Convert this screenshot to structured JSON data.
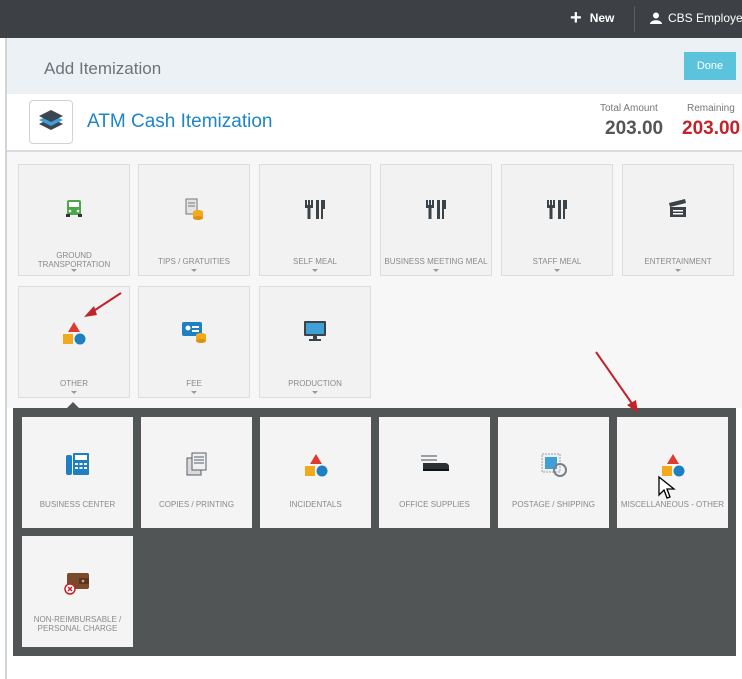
{
  "topbar": {
    "new_label": "New",
    "user_label": "CBS Employee"
  },
  "header": {
    "title": "Add Itemization",
    "done_label": "Done"
  },
  "itemization": {
    "name": "ATM Cash Itemization",
    "total_label": "Total Amount",
    "total_value": "203.00",
    "remaining_label": "Remaining",
    "remaining_value": "203.00"
  },
  "categories": [
    {
      "label": "GROUND TRANSPORTATION",
      "icon": "car-icon"
    },
    {
      "label": "TIPS / GRATUITIES",
      "icon": "tips-icon"
    },
    {
      "label": "SELF MEAL",
      "icon": "fork-knife-icon"
    },
    {
      "label": "BUSINESS MEETING MEAL",
      "icon": "fork-knife-icon"
    },
    {
      "label": "STAFF MEAL",
      "icon": "fork-knife-icon"
    },
    {
      "label": "ENTERTAINMENT",
      "icon": "clapperboard-icon"
    },
    {
      "label": "OTHER",
      "icon": "shapes-icon"
    },
    {
      "label": "FEE",
      "icon": "fee-icon"
    },
    {
      "label": "PRODUCTION",
      "icon": "monitor-icon"
    }
  ],
  "subcategories": [
    {
      "label": "BUSINESS CENTER",
      "icon": "fax-icon"
    },
    {
      "label": "COPIES / PRINTING",
      "icon": "copies-icon"
    },
    {
      "label": "INCIDENTALS",
      "icon": "shapes-icon"
    },
    {
      "label": "OFFICE SUPPLIES",
      "icon": "stapler-icon"
    },
    {
      "label": "POSTAGE / SHIPPING",
      "icon": "postage-icon"
    },
    {
      "label": "MISCELLANEOUS - OTHER",
      "icon": "shapes-icon"
    },
    {
      "label": "NON-REIMBURSABLE / PERSONAL CHARGE",
      "icon": "wallet-icon"
    }
  ],
  "colors": {
    "accent": "#1d86c8",
    "remaining": "#c4222a",
    "done": "#5cc3dd",
    "annotation_arrow": "#c0242a"
  }
}
